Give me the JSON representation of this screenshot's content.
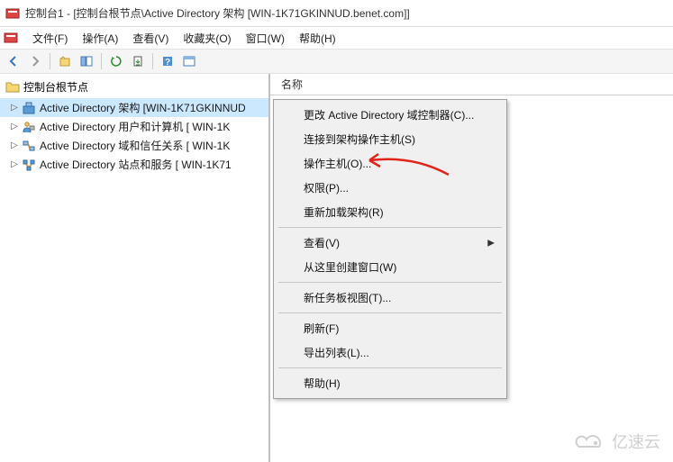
{
  "window": {
    "title": "控制台1 - [控制台根节点\\Active Directory 架构 [WIN-1K71GKINNUD.benet.com]]"
  },
  "menu": {
    "file": "文件(F)",
    "action": "操作(A)",
    "view": "查看(V)",
    "favorites": "收藏夹(O)",
    "window": "窗口(W)",
    "help": "帮助(H)"
  },
  "tree": {
    "root": "控制台根节点",
    "items": [
      "Active Directory 架构 [WIN-1K71GKINNUD",
      "Active Directory 用户和计算机 [ WIN-1K",
      "Active Directory 域和信任关系 [ WIN-1K",
      "Active Directory 站点和服务 [ WIN-1K71"
    ]
  },
  "list": {
    "column_name": "名称"
  },
  "context_menu": {
    "change_dc": "更改 Active Directory 域控制器(C)...",
    "connect_schema": "连接到架构操作主机(S)",
    "operations_master": "操作主机(O)...",
    "permissions": "权限(P)...",
    "reload_schema": "重新加载架构(R)",
    "view": "查看(V)",
    "new_window": "从这里创建窗口(W)",
    "new_taskpad": "新任务板视图(T)...",
    "refresh": "刷新(F)",
    "export_list": "导出列表(L)...",
    "help": "帮助(H)"
  },
  "watermark": "亿速云"
}
